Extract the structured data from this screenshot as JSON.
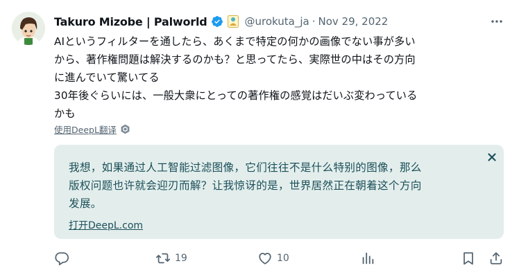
{
  "tweet": {
    "author_name": "Takuro Mizobe | Palworld",
    "handle": "@urokuta_ja",
    "separator": "·",
    "date": "Nov 29, 2022",
    "text": "AIというフィルターを通したら、あくまで特定の何かの画像でない事が多い\nから、著作権問題は解決するのかも？と思ってたら、実際世の中はその方向\nに進んでいて驚いてる\n30年後ぐらいには、一般大衆にとっての著作権の感覚はだいぶ変わっている\nかも"
  },
  "translation": {
    "link_label": "使用DeepL翻译",
    "text": "我想，如果通过人工智能过滤图像，它们往往不是什么特别的图像，那么\n版权问题也许就会迎刃而解？让我惊讶的是，世界居然正在朝着这个方向\n发展。",
    "open_label": "打开DeepL.com"
  },
  "actions": {
    "reply_count": "",
    "retweet_count": "19",
    "like_count": "10"
  },
  "icons": {
    "verified": "verified-badge-icon",
    "affiliate": "affiliate-badge-icon",
    "more": "more-dots-icon",
    "gear": "settings-gear-icon",
    "close": "close-icon",
    "reply": "reply-icon",
    "retweet": "retweet-icon",
    "like": "heart-icon",
    "views": "analytics-icon",
    "bookmark": "bookmark-icon",
    "share": "share-icon"
  },
  "colors": {
    "verified_blue": "#1d9bf0",
    "secondary_text": "#536471",
    "translation_bg": "#e3eeec",
    "translation_text": "#1b4f59"
  }
}
